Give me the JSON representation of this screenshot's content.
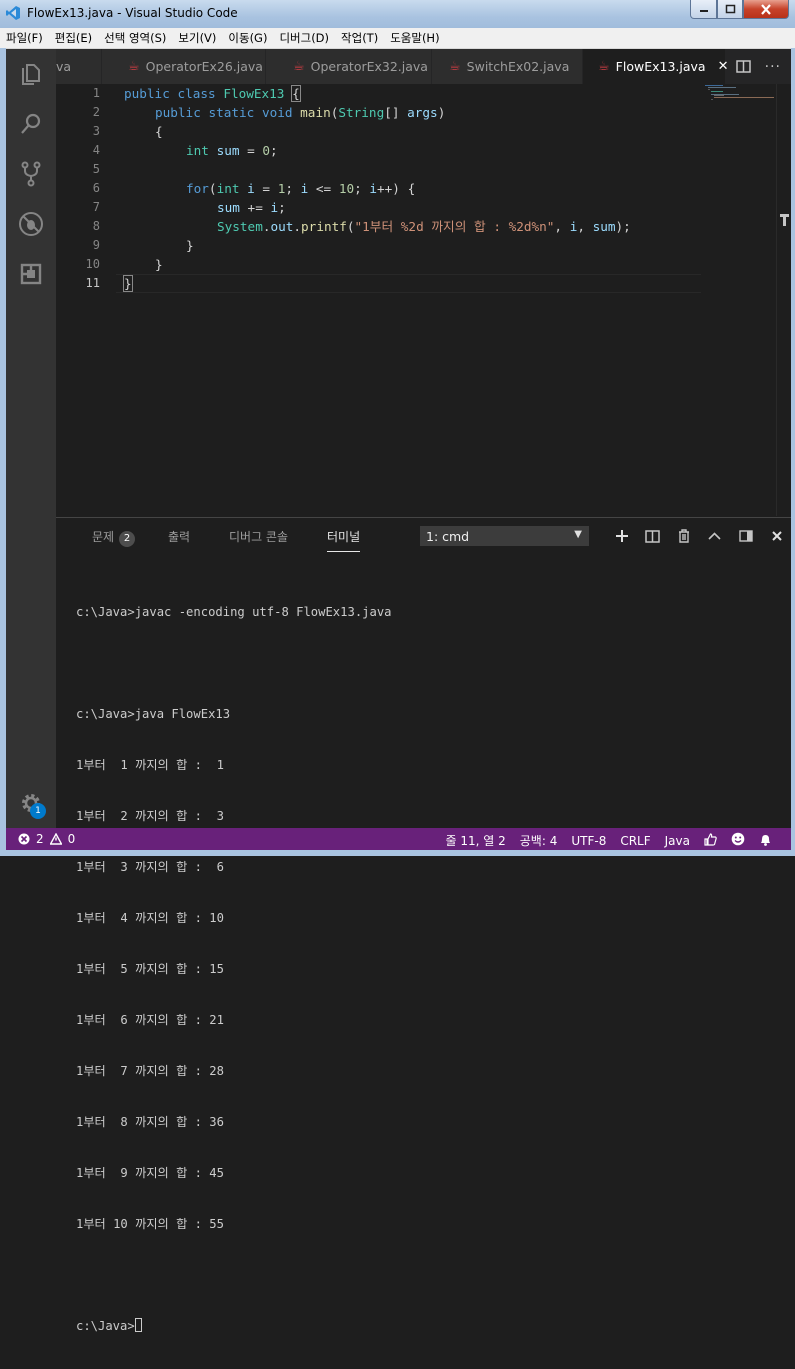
{
  "window": {
    "title": "FlowEx13.java - Visual Studio Code"
  },
  "menu": [
    "파일(F)",
    "편집(E)",
    "선택 영역(S)",
    "보기(V)",
    "이동(G)",
    "디버그(D)",
    "작업(T)",
    "도움말(H)"
  ],
  "tabs": [
    {
      "label": "va",
      "active": false
    },
    {
      "label": "OperatorEx26.java",
      "active": false
    },
    {
      "label": "OperatorEx32.java",
      "active": false
    },
    {
      "label": "SwitchEx02.java",
      "active": false
    },
    {
      "label": "FlowEx13.java",
      "active": true
    }
  ],
  "editor": {
    "lines": [
      "1",
      "2",
      "3",
      "4",
      "5",
      "6",
      "7",
      "8",
      "9",
      "10",
      "11"
    ],
    "current_line": 11
  },
  "code": {
    "l1": {
      "kw1": "public",
      "kw2": "class",
      "cls": "FlowEx13",
      "brace": "{"
    },
    "l2": {
      "kw1": "public",
      "kw2": "static",
      "kw3": "void",
      "fn": "main",
      "p1": "(",
      "ty": "String",
      "p2": "[] ",
      "va": "args",
      "p3": ")"
    },
    "l3": "{",
    "l4": {
      "kw": "int",
      "va": "sum",
      "op": " = ",
      "nu": "0",
      "end": ";"
    },
    "l6": {
      "kw": "for",
      "p1": "(",
      "kw2": "int",
      "va1": "i",
      "op1": " = ",
      "nu1": "1",
      "p2": "; ",
      "va2": "i",
      "op2": " <= ",
      "nu2": "10",
      "p3": "; ",
      "va3": "i",
      "op3": "++) {"
    },
    "l7": {
      "va1": "sum",
      "op": " += ",
      "va2": "i",
      "end": ";"
    },
    "l8": {
      "cls": "System",
      "dot1": ".",
      "fld": "out",
      "dot2": ".",
      "fn": "printf",
      "p1": "(",
      "str": "\"1부터 %2d 까지의 합 : %2d%n\"",
      "p2": ", ",
      "va1": "i",
      "p3": ", ",
      "va2": "sum",
      "p4": ");"
    },
    "l9": "}",
    "l10": "}",
    "l11": "}"
  },
  "panel": {
    "tabs": [
      "문제",
      "출력",
      "디버그 콘솔",
      "터미널"
    ],
    "problems_count": "2",
    "active_tab": "터미널",
    "terminal_select": "1: cmd"
  },
  "terminal": {
    "lines": [
      "c:\\Java>javac -encoding utf-8 FlowEx13.java",
      "",
      "c:\\Java>java FlowEx13",
      "1부터  1 까지의 합 :  1",
      "1부터  2 까지의 합 :  3",
      "1부터  3 까지의 합 :  6",
      "1부터  4 까지의 합 : 10",
      "1부터  5 까지의 합 : 15",
      "1부터  6 까지의 합 : 21",
      "1부터  7 까지의 합 : 28",
      "1부터  8 까지의 합 : 36",
      "1부터  9 까지의 합 : 45",
      "1부터 10 까지의 합 : 55",
      ""
    ],
    "prompt": "c:\\Java>"
  },
  "status": {
    "errors": "2",
    "warnings": "0",
    "position": "줄 11, 열 2",
    "spaces": "공백: 4",
    "encoding": "UTF-8",
    "eol": "CRLF",
    "language": "Java"
  },
  "settings_badge": "1",
  "colors": {
    "status_bar": "#68217a",
    "accent": "#007acc",
    "editor_bg": "#1e1e1e"
  }
}
